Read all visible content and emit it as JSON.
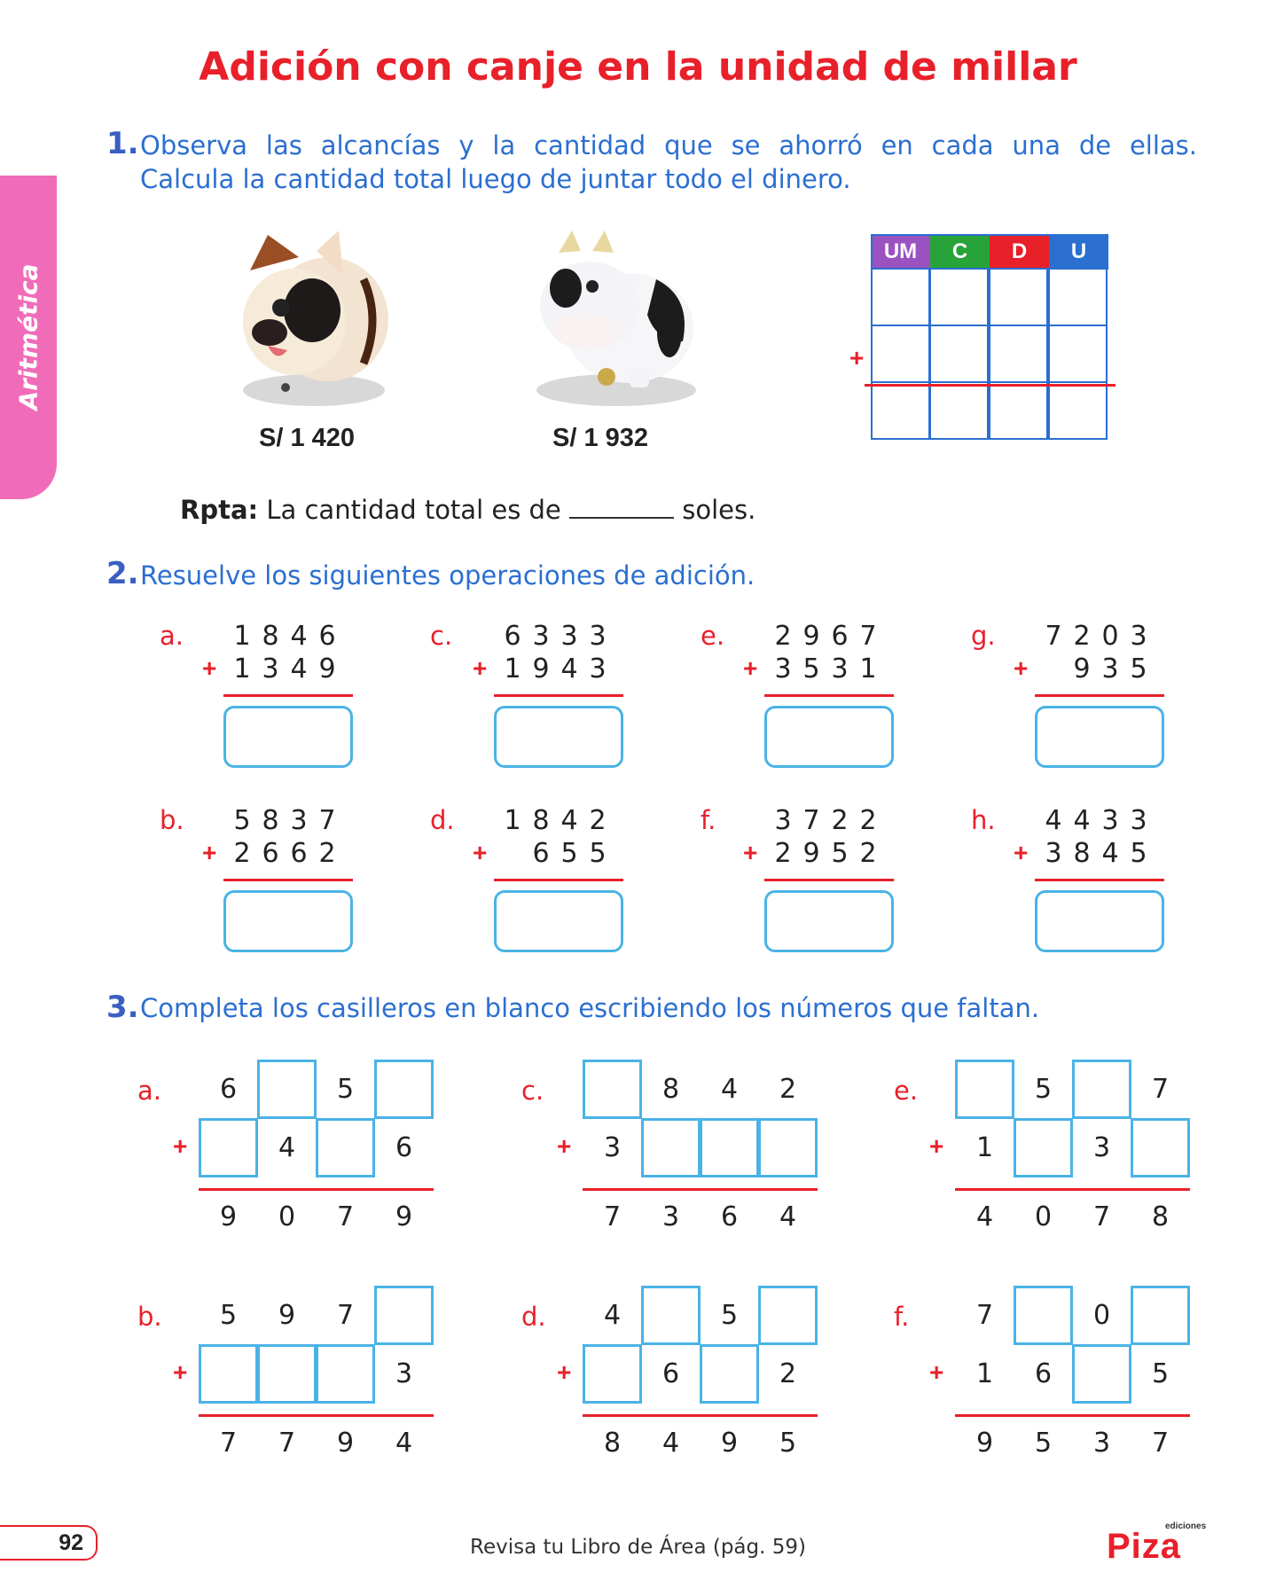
{
  "title": "Adición con canje en la unidad de millar",
  "side_tab": "Aritmética",
  "q1": {
    "number": "1.",
    "text_line1": "Observa las alcancías y la cantidad que se ahorró en cada una de ellas.",
    "text_line2": "Calcula la cantidad total luego de juntar todo el dinero.",
    "bank1_price": "S/ 1 420",
    "bank2_price": "S/ 1 932",
    "table_headers": [
      "UM",
      "C",
      "D",
      "U"
    ],
    "header_colors": [
      "#9a52c0",
      "#27a33a",
      "#e8202a",
      "#2b6fd1"
    ],
    "plus_sign": "+",
    "answer_label": "Rpta:",
    "answer_text_before": "La cantidad total es de",
    "answer_text_after": "soles."
  },
  "q2": {
    "number": "2.",
    "text": "Resuelve los siguientes operaciones de adición.",
    "exercises": [
      {
        "letter": "a.",
        "top": "1846",
        "bottom": "1349"
      },
      {
        "letter": "c.",
        "top": "6333",
        "bottom": "1943"
      },
      {
        "letter": "e.",
        "top": "2967",
        "bottom": "3531"
      },
      {
        "letter": "g.",
        "top": "7203",
        "bottom": "935"
      },
      {
        "letter": "b.",
        "top": "5837",
        "bottom": "2662"
      },
      {
        "letter": "d.",
        "top": "1842",
        "bottom": "655"
      },
      {
        "letter": "f.",
        "top": "3722",
        "bottom": "2952"
      },
      {
        "letter": "h.",
        "top": "4433",
        "bottom": "3845"
      }
    ]
  },
  "q3": {
    "number": "3.",
    "text": "Completa los casilleros en blanco escribiendo los números que faltan.",
    "exercises": [
      {
        "letter": "a.",
        "top": [
          "6",
          "",
          "5",
          ""
        ],
        "bottom": [
          "",
          "4",
          "",
          "6"
        ],
        "result": [
          "9",
          "0",
          "7",
          "9"
        ]
      },
      {
        "letter": "c.",
        "top": [
          "",
          "8",
          "4",
          "2"
        ],
        "bottom": [
          "3",
          "",
          "",
          ""
        ],
        "result": [
          "7",
          "3",
          "6",
          "4"
        ]
      },
      {
        "letter": "e.",
        "top": [
          "",
          "5",
          "",
          "7"
        ],
        "bottom": [
          "1",
          "",
          "3",
          ""
        ],
        "result": [
          "4",
          "0",
          "7",
          "8"
        ]
      },
      {
        "letter": "b.",
        "top": [
          "5",
          "9",
          "7",
          ""
        ],
        "bottom": [
          "",
          "",
          "",
          "3"
        ],
        "result": [
          "7",
          "7",
          "9",
          "4"
        ]
      },
      {
        "letter": "d.",
        "top": [
          "4",
          "",
          "5",
          ""
        ],
        "bottom": [
          "",
          "6",
          "",
          "2"
        ],
        "result": [
          "8",
          "4",
          "9",
          "5"
        ]
      },
      {
        "letter": "f.",
        "top": [
          "7",
          "",
          "0",
          ""
        ],
        "bottom": [
          "1",
          "6",
          "",
          "5"
        ],
        "result": [
          "9",
          "5",
          "3",
          "7"
        ]
      }
    ]
  },
  "footer": {
    "page_number": "92",
    "text": "Revisa tu Libro de Área (pág. 59)",
    "logo_small": "ediciones",
    "logo_big": "Piza"
  }
}
